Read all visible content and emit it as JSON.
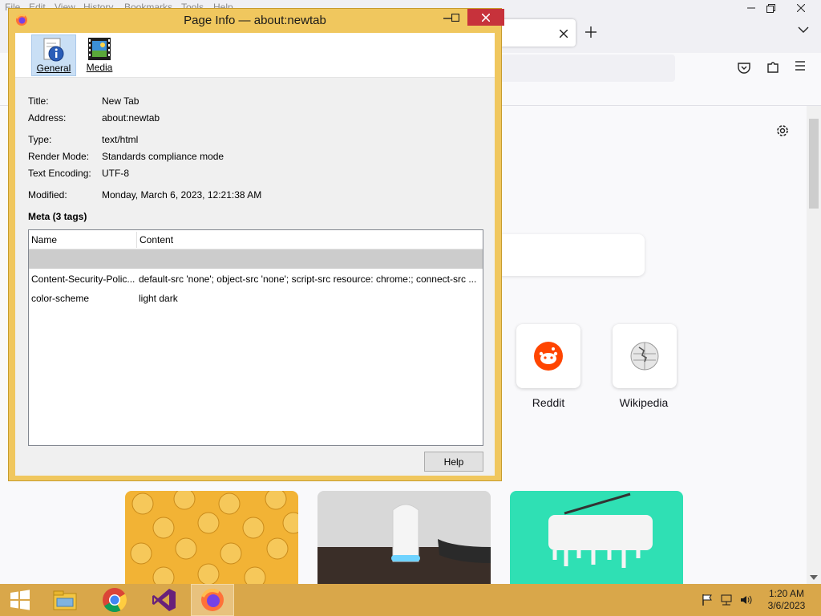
{
  "browser": {
    "menu": [
      "File",
      "Edit",
      "View",
      "History",
      "Bookmarks",
      "Tools",
      "Help"
    ],
    "shortcuts": [
      "Reddit",
      "Wikipedia"
    ]
  },
  "dialog": {
    "title": "Page Info — about:newtab",
    "tabs": [
      {
        "label": "General",
        "icon": "info-icon"
      },
      {
        "label": "Media",
        "icon": "film-icon"
      }
    ],
    "fields": [
      {
        "label": "Title:",
        "value": "New Tab"
      },
      {
        "label": "Address:",
        "value": "about:newtab"
      },
      {
        "label": "Type:",
        "value": "text/html"
      },
      {
        "label": "Render Mode:",
        "value": "Standards compliance mode"
      },
      {
        "label": "Text Encoding:",
        "value": "UTF-8"
      },
      {
        "label": "Modified:",
        "value": "Monday, March 6, 2023, 12:21:38 AM"
      }
    ],
    "meta_heading": "Meta (3 tags)",
    "meta_columns": [
      "Name",
      "Content"
    ],
    "meta_rows": [
      {
        "name": "Content-Security-Polic...",
        "content": "default-src 'none'; object-src 'none'; script-src resource: chrome:; connect-src ..."
      },
      {
        "name": "color-scheme",
        "content": "light dark"
      }
    ],
    "help_label": "Help"
  },
  "taskbar": {
    "apps": [
      "start-icon",
      "file-explorer-icon",
      "chrome-icon",
      "visual-studio-icon",
      "firefox-icon"
    ],
    "clock_time": "1:20 AM",
    "clock_date": "3/6/2023"
  },
  "colors": {
    "dialog_frame": "#f0c75e",
    "taskbar": "#d9a74a",
    "close_button": "#c7323b",
    "selected_tab": "#c9dff5"
  }
}
